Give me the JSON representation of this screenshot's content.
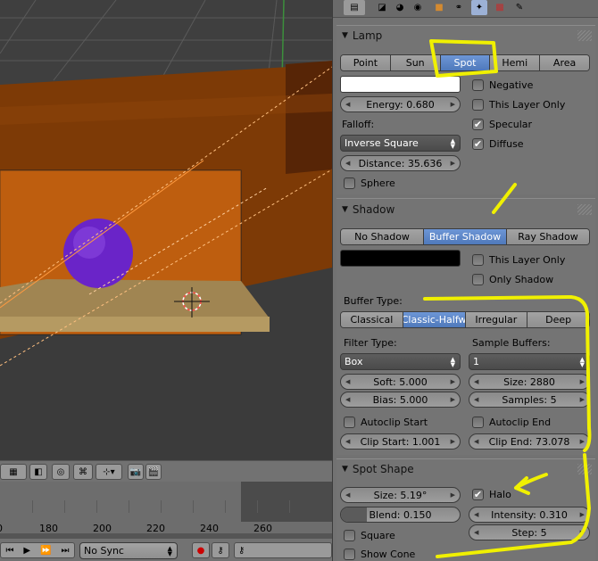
{
  "colors": {
    "accent": "#5680c2",
    "lamp_color": "#ffffff",
    "shadow_color": "#000000",
    "annotation": "#f0f000",
    "sphere": "#6a24c8",
    "room": "#8a3c00"
  },
  "tabs": [
    "render-icon",
    "scene-icon",
    "world-icon",
    "object-icon",
    "constraints-icon",
    "modifiers-icon",
    "texture-icon",
    "lamp-data-icon"
  ],
  "lamp": {
    "title": "Lamp",
    "types": [
      "Point",
      "Sun",
      "Spot",
      "Hemi",
      "Area"
    ],
    "selected_type": "Spot",
    "energy": "Energy: 0.680",
    "falloff_label": "Falloff:",
    "falloff_value": "Inverse Square",
    "distance": "Distance: 35.636",
    "sphere": "Sphere",
    "negative": "Negative",
    "this_layer_only": "This Layer Only",
    "specular": "Specular",
    "diffuse": "Diffuse"
  },
  "shadow": {
    "title": "Shadow",
    "types": [
      "No Shadow",
      "Buffer Shadow",
      "Ray Shadow"
    ],
    "selected_type": "Buffer Shadow",
    "this_layer_only": "This Layer Only",
    "only_shadow": "Only Shadow",
    "buffer_type_label": "Buffer Type:",
    "buffer_types": [
      "Classical",
      "Classic-Halfw",
      "Irregular",
      "Deep"
    ],
    "selected_buffer": "Classic-Halfw",
    "filter_type_label": "Filter Type:",
    "filter_type_value": "Box",
    "sample_buffers_label": "Sample Buffers:",
    "sample_buffers_value": "1",
    "soft": "Soft: 5.000",
    "bias": "Bias: 5.000",
    "size": "Size: 2880",
    "samples": "Samples: 5",
    "autoclip_start": "Autoclip Start",
    "autoclip_end": "Autoclip End",
    "clip_start": "Clip Start: 1.001",
    "clip_end": "Clip End: 73.078"
  },
  "spot": {
    "title": "Spot Shape",
    "size": "Size: 5.19°",
    "blend": "Blend: 0.150",
    "blend_fraction": 0.15,
    "square": "Square",
    "show_cone": "Show Cone",
    "halo": "Halo",
    "intensity": "Intensity: 0.310",
    "step": "Step: 5"
  },
  "timeline": {
    "frames": [
      "0",
      "180",
      "200",
      "220",
      "240",
      "260"
    ]
  },
  "playback": {
    "sync": "No Sync"
  }
}
